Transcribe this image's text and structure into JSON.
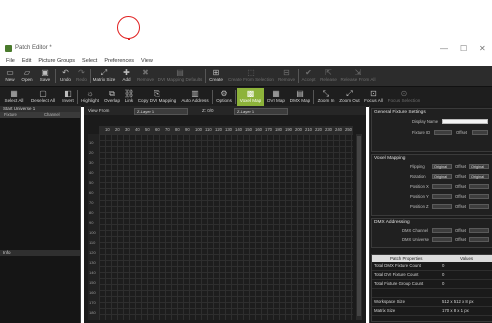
{
  "window": {
    "title": "Patch Editor *",
    "minimize": "—",
    "maximize": "☐",
    "close": "✕"
  },
  "menu": [
    "File",
    "Edit",
    "Picture Groups",
    "Select",
    "Preferences",
    "View"
  ],
  "toolbar1": [
    {
      "label": "New",
      "icon": "new-file-icon",
      "glyph": "▭",
      "dim": false
    },
    {
      "label": "Open",
      "icon": "open-folder-icon",
      "glyph": "▱",
      "dim": false
    },
    {
      "label": "Save",
      "icon": "save-icon",
      "glyph": "▣",
      "dim": false
    },
    {
      "label": "Undo",
      "icon": "undo-icon",
      "glyph": "↶",
      "dim": false
    },
    {
      "label": "Redo",
      "icon": "redo-icon",
      "glyph": "↷",
      "dim": true
    },
    {
      "label": "Matrix Size",
      "icon": "matrix-size-icon",
      "glyph": "⤢",
      "dim": false
    },
    {
      "label": "Add",
      "icon": "add-icon",
      "glyph": "✚",
      "dim": false
    },
    {
      "label": "Remove",
      "icon": "remove-icon",
      "glyph": "✖",
      "dim": true
    },
    {
      "label": "DVI Mapping Defaults",
      "icon": "dvi-mapping-icon",
      "glyph": "▤",
      "dim": true
    },
    {
      "label": "Create",
      "icon": "create-icon",
      "glyph": "⊞",
      "dim": false
    },
    {
      "label": "Create From Selection",
      "icon": "create-from-selection-icon",
      "glyph": "⬚",
      "dim": true
    },
    {
      "label": "Remove",
      "icon": "remove-group-icon",
      "glyph": "⊟",
      "dim": true
    },
    {
      "label": "Accept",
      "icon": "accept-icon",
      "glyph": "✔",
      "dim": true
    },
    {
      "label": "Release",
      "icon": "release-icon",
      "glyph": "⇱",
      "dim": true
    },
    {
      "label": "Release From All",
      "icon": "release-all-icon",
      "glyph": "⇲",
      "dim": true
    }
  ],
  "toolbar2": [
    {
      "label": "Select All",
      "icon": "select-all-icon",
      "glyph": "▦",
      "hl": false
    },
    {
      "label": "Deselect All",
      "icon": "deselect-all-icon",
      "glyph": "▢",
      "hl": false
    },
    {
      "label": "Invert",
      "icon": "invert-icon",
      "glyph": "◧",
      "hl": false
    },
    {
      "label": "Highlight",
      "icon": "highlight-icon",
      "glyph": "☼",
      "hl": false
    },
    {
      "label": "Overlap",
      "icon": "overlap-icon",
      "glyph": "⧉",
      "hl": false
    },
    {
      "label": "Link",
      "icon": "link-icon",
      "glyph": "⛓",
      "hl": false
    },
    {
      "label": "Copy DVI Mapping",
      "icon": "copy-dvi-icon",
      "glyph": "⎘",
      "hl": false
    },
    {
      "label": "Auto Address",
      "icon": "auto-address-icon",
      "glyph": "▥",
      "hl": false
    },
    {
      "label": "Options",
      "icon": "options-gear-icon",
      "glyph": "⚙",
      "hl": false
    },
    {
      "label": "Voxel Map",
      "icon": "voxel-map-icon",
      "glyph": "▩",
      "hl": true
    },
    {
      "label": "DVI Map",
      "icon": "dvi-map-icon",
      "glyph": "▦",
      "hl": false
    },
    {
      "label": "DMX Map",
      "icon": "dmx-map-icon",
      "glyph": "▤",
      "hl": false
    },
    {
      "label": "Zoom In",
      "icon": "zoom-in-icon",
      "glyph": "⤡",
      "hl": false
    },
    {
      "label": "Zoom Out",
      "icon": "zoom-out-icon",
      "glyph": "⤢",
      "hl": false
    },
    {
      "label": "Focus All",
      "icon": "focus-all-icon",
      "glyph": "⊡",
      "hl": false
    },
    {
      "label": "Focus Selection",
      "icon": "focus-selection-icon",
      "glyph": "⊙",
      "hl": false
    }
  ],
  "left": {
    "header": "Start Universe 1",
    "col1": "Fixture",
    "col2": "Channel",
    "header2": "Info"
  },
  "canvas": {
    "view_from_label": "View From",
    "view_from_value": "Z-Layer 1",
    "viewing_label": "Z: 0/0",
    "layer_value": "Z-Layer 1",
    "ruler": [
      "10",
      "20",
      "30",
      "40",
      "50",
      "60",
      "70",
      "80",
      "90",
      "100",
      "110",
      "120",
      "130",
      "140",
      "150",
      "160",
      "170",
      "180",
      "190",
      "200",
      "210",
      "220",
      "230",
      "240",
      "250"
    ],
    "vruler": [
      "10",
      "20",
      "30",
      "40",
      "50",
      "60",
      "70",
      "80",
      "90",
      "100",
      "110",
      "120",
      "130",
      "140",
      "150",
      "160",
      "170",
      "180"
    ]
  },
  "right": {
    "general": {
      "title": "General Fixture Settings",
      "display_name_label": "Display Name",
      "fixture_id_label": "Fixture ID",
      "offset_label": "Offset"
    },
    "voxel": {
      "title": "Voxel Mapping",
      "rows": [
        {
          "label": "Flipping",
          "v1": "Original",
          "v2": "Offset",
          "v3": "Original"
        },
        {
          "label": "Rotation",
          "v1": "Original",
          "v2": "Offset",
          "v3": "Original"
        },
        {
          "label": "Position X",
          "v1": "",
          "v2": "Offset",
          "v3": ""
        },
        {
          "label": "Position Y",
          "v1": "",
          "v2": "Offset",
          "v3": ""
        },
        {
          "label": "Position Z",
          "v1": "",
          "v2": "Offset",
          "v3": ""
        }
      ]
    },
    "dmx": {
      "title": "DMX Addressing",
      "rows": [
        {
          "label": "DMX Channel",
          "v2": "Offset"
        },
        {
          "label": "DMX Universe",
          "v2": "Offset"
        }
      ]
    },
    "props": {
      "col1": "Patch Properties",
      "col2": "Values",
      "rows": [
        {
          "k": "Total DMX Fixture Count",
          "v": "0"
        },
        {
          "k": "Total DVI Fixture Count",
          "v": "0"
        },
        {
          "k": "Total Fixture Group Count",
          "v": "0"
        },
        {
          "k": "",
          "v": ""
        },
        {
          "k": "Workspace Size",
          "v": "512 x 512 x 8 px"
        },
        {
          "k": "Matrix Size",
          "v": "170 x 8 x 1 px"
        }
      ]
    }
  },
  "colors": {
    "accent_green": "#8db33a",
    "annotation_red": "#e02020"
  }
}
